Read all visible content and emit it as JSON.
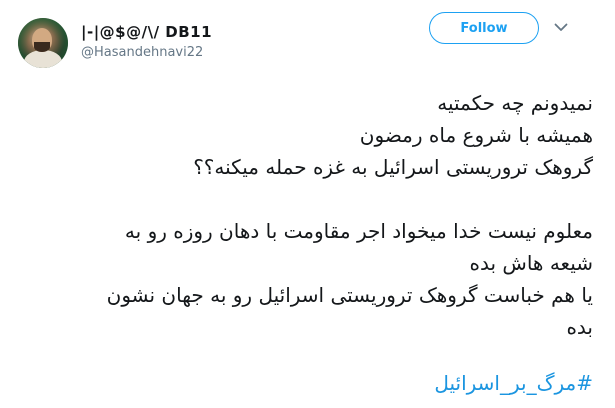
{
  "user": {
    "display_name": "|-|@$@/\\/ DB11",
    "handle": "@Hasandehnavi22",
    "avatar_icon": "profile-photo"
  },
  "actions": {
    "follow_label": "Follow",
    "menu_icon": "chevron-down-icon"
  },
  "tweet": {
    "lines": [
      "نمیدونم چه حکمتیه",
      "همیشه با شروع ماه رمضون",
      "گروهک تروریستی اسرائیل به غزه حمله میکنه؟؟",
      "",
      "معلوم نیست خدا میخواد اجر مقاومت با دهان روزه رو به",
      "شیعه هاش بده",
      "یا هم خباست گروهک تروریستی اسرائیل رو به جهان نشون",
      "بده"
    ],
    "hashtag": "#مرگ_بر_اسرائیل"
  },
  "colors": {
    "accent": "#1da1f2",
    "hashtag": "#1b95e0",
    "text": "#14171a",
    "secondary": "#657786"
  }
}
